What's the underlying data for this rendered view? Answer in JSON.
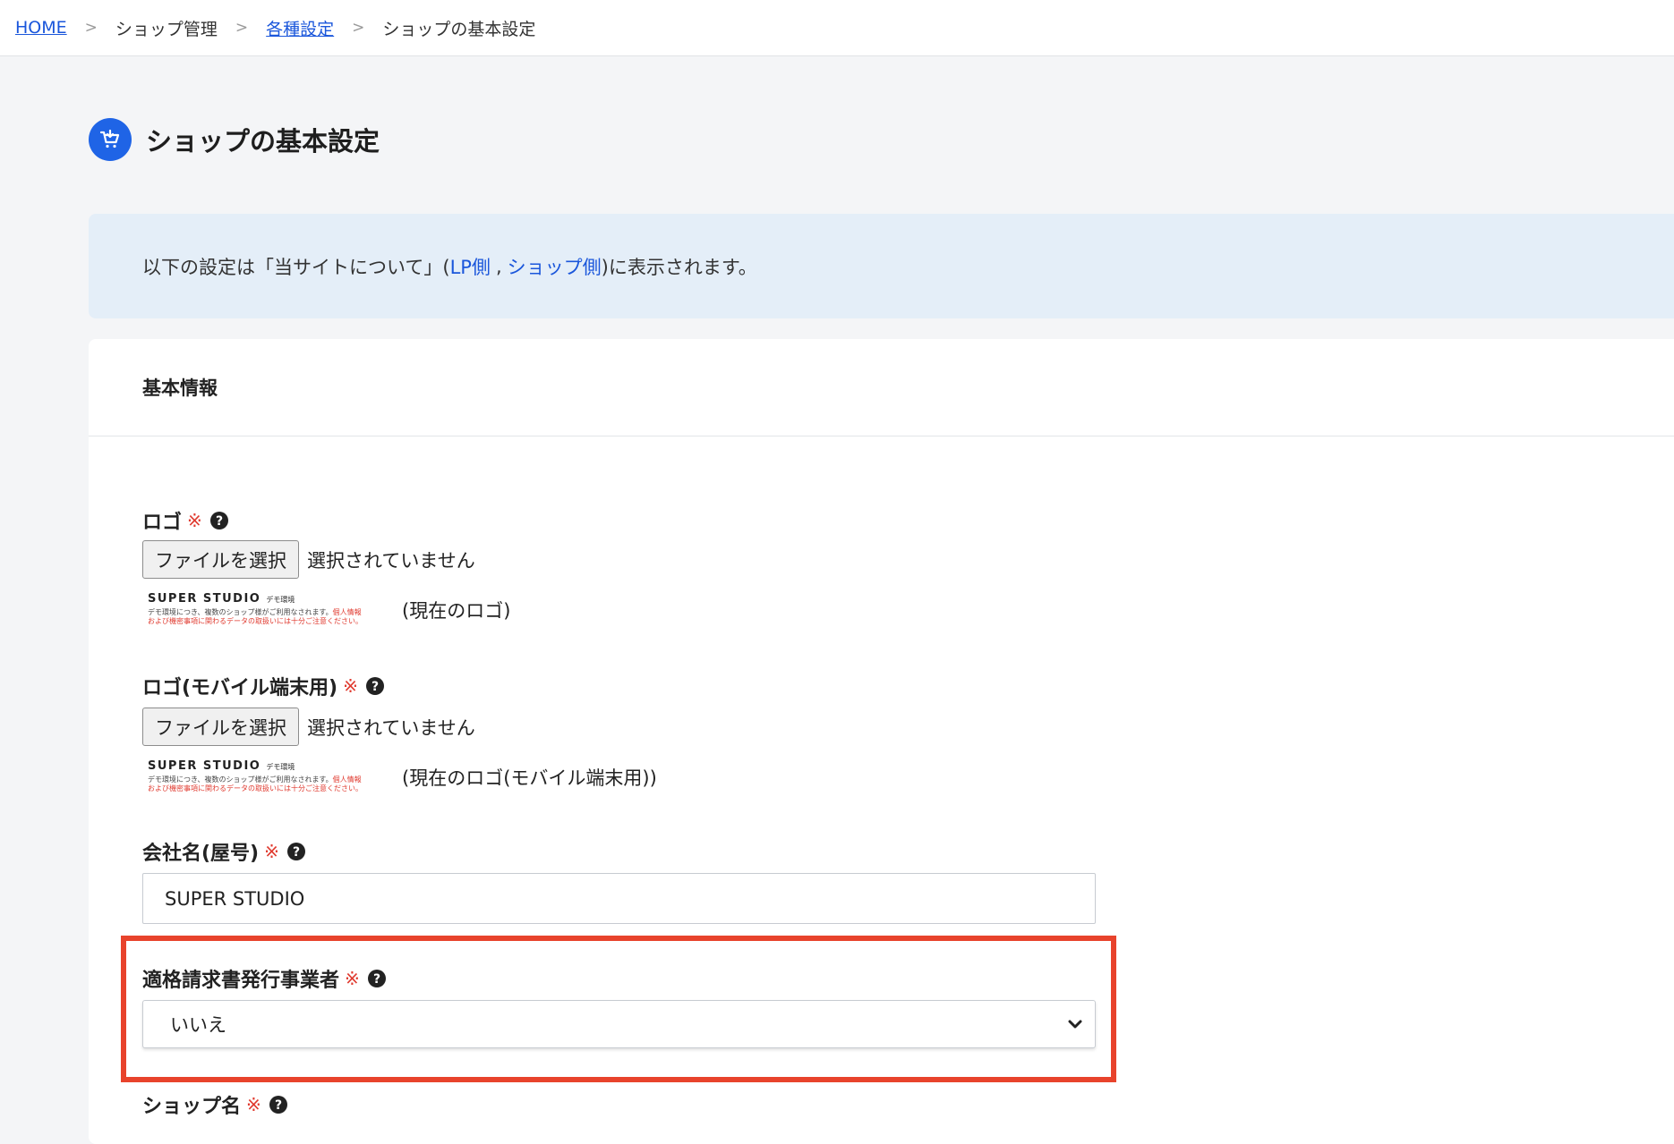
{
  "breadcrumb": {
    "items": [
      {
        "label": "HOME",
        "link": true
      },
      {
        "label": "ショップ管理",
        "link": false
      },
      {
        "label": "各種設定",
        "link": true
      },
      {
        "label": "ショップの基本設定",
        "link": false
      }
    ],
    "separator": ">"
  },
  "page": {
    "title": "ショップの基本設定",
    "icon": "shop-cart-icon"
  },
  "info_banner": {
    "prefix": "以下の設定は「当サイトについて」(",
    "link_lp": "LP側",
    "comma": ",",
    "link_shop": "ショップ側",
    "suffix": ")に表示されます。"
  },
  "card": {
    "header": "基本情報"
  },
  "form": {
    "required_mark": "※",
    "logo": {
      "label": "ロゴ",
      "file_button": "ファイルを選択",
      "file_status": "選択されていません",
      "current_caption": "(現在のロゴ)"
    },
    "logo_mobile": {
      "label": "ロゴ(モバイル端末用)",
      "file_button": "ファイルを選択",
      "file_status": "選択されていません",
      "current_caption": "(現在のロゴ(モバイル端末用))"
    },
    "company": {
      "label": "会社名(屋号)",
      "value": "SUPER STUDIO"
    },
    "invoice_issuer": {
      "label": "適格請求書発行事業者",
      "selected": "いいえ"
    },
    "shop_name": {
      "label": "ショップ名"
    }
  },
  "logo_image": {
    "brand": "SUPER STUDIO",
    "brand_sub": "デモ環境",
    "line1": "デモ環境につき、複数のショップ様がご利用なされます。",
    "line1_red": "個人情報",
    "line2": "および機密事項に関わるデータの取扱いには十分ご注意ください。"
  },
  "colors": {
    "accent": "#1f64e6",
    "link": "#1a56db",
    "required": "#e03a2f",
    "highlight": "#e8432c",
    "banner_bg": "#e4eef8"
  }
}
